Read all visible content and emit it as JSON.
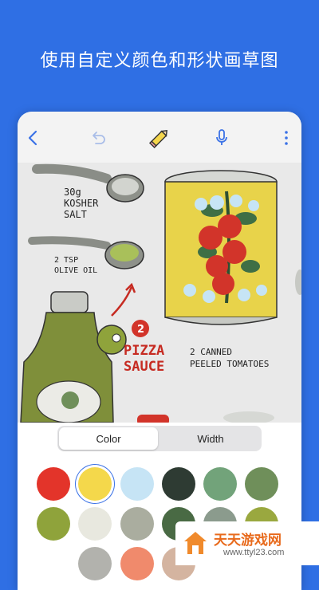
{
  "headline": "使用自定义颜色和形状画草图",
  "sketch": {
    "salt_text": "30g\nKOSHER\nSALT",
    "oil_text": "2 TSP\nOLIVE OIL",
    "step_number": "2",
    "pizza_sauce": "PIZZA\nSAUCE",
    "canned_text": "2 CANNED\nPEELED TOMATOES"
  },
  "tabs": [
    {
      "label": "Color",
      "active": true
    },
    {
      "label": "Width",
      "active": false
    }
  ],
  "swatches_row1": [
    "#e3342a",
    "#f4d84b",
    "#c6e4f5",
    "#2e3b33",
    "#72a37a",
    "#6f8f5a"
  ],
  "swatches_row2": [
    "#8fa33b",
    "#e8e8df",
    "#aaad9f",
    "#496a44",
    "#8b9b8d",
    "#9aa83f"
  ],
  "swatches_row3": [
    "#b2b2ad",
    "#f08a6c",
    "#d4b4a0"
  ],
  "selected_swatch": "#f4d84b",
  "watermark": {
    "title": "天天游戏网",
    "url": "www.ttyl23.com"
  }
}
